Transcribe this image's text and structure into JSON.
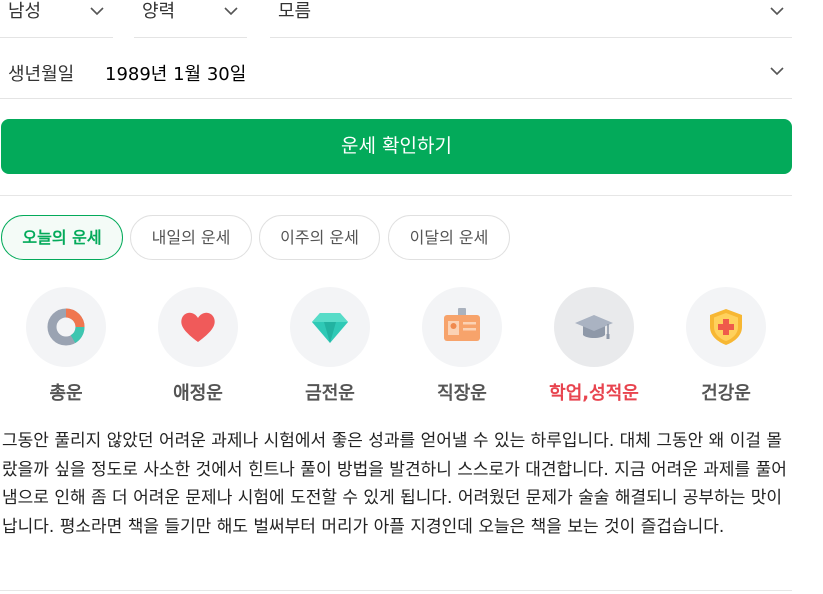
{
  "selects": {
    "gender": "남성",
    "calendar": "양력",
    "time": "모름"
  },
  "birth": {
    "label": "생년월일",
    "value": "1989년 1월 30일"
  },
  "check_button": "운세 확인하기",
  "tabs": [
    {
      "label": "오늘의 운세",
      "active": true
    },
    {
      "label": "내일의 운세",
      "active": false
    },
    {
      "label": "이주의 운세",
      "active": false
    },
    {
      "label": "이달의 운세",
      "active": false
    }
  ],
  "categories": [
    {
      "label": "총운",
      "icon": "donut-chart-icon",
      "active": false
    },
    {
      "label": "애정운",
      "icon": "heart-icon",
      "active": false
    },
    {
      "label": "금전운",
      "icon": "diamond-icon",
      "active": false
    },
    {
      "label": "직장운",
      "icon": "id-badge-icon",
      "active": false
    },
    {
      "label": "학업,성적운",
      "icon": "graduation-cap-icon",
      "active": true
    },
    {
      "label": "건강운",
      "icon": "health-shield-icon",
      "active": false
    }
  ],
  "fortune_text": "그동안 풀리지 않았던 어려운 과제나 시험에서 좋은 성과를 얻어낼 수 있는 하루입니다. 대체 그동안 왜 이걸 몰랐을까 싶을 정도로 사소한 것에서 힌트나 풀이 방법을 발견하니 스스로가 대견합니다. 지금 어려운 과제를 풀어냄으로 인해 좀 더 어려운 문제나 시험에 도전할 수 있게 됩니다. 어려웠던 문제가 술술 해결되니 공부하는 맛이 납니다. 평소라면 책을 들기만 해도 벌써부터 머리가 아플 지경인데 오늘은 책을 보는 것이 즐겁습니다.",
  "colors": {
    "accent": "#03aa5a",
    "active_category": "#e8444f"
  }
}
